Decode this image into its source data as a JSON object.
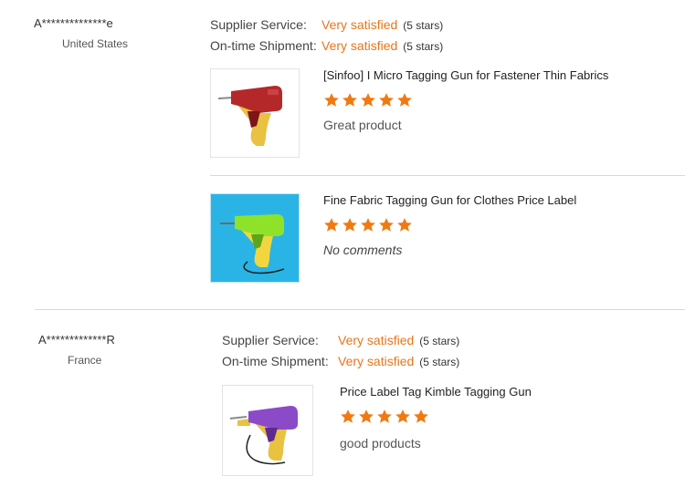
{
  "reviews": [
    {
      "buyer": {
        "name": "A**************e",
        "country": "United States"
      },
      "supplier_service": {
        "label": "Supplier Service:",
        "value": "Very satisfied",
        "stars": "(5 stars)"
      },
      "shipment": {
        "label": "On-time Shipment:",
        "value": "Very satisfied",
        "stars": "(5 stars)"
      },
      "products": [
        {
          "title": "[Sinfoo] I Micro Tagging Gun for Fastener Thin Fabrics",
          "rating": 5,
          "comment": "Great product",
          "image": "red-tagging-gun-image"
        },
        {
          "title": "Fine Fabric Tagging Gun for Clothes Price Label",
          "rating": 5,
          "comment": "No comments",
          "image": "green-tagging-gun-image"
        }
      ]
    },
    {
      "buyer": {
        "name": "A*************R",
        "country": "France"
      },
      "supplier_service": {
        "label": "Supplier Service:",
        "value": "Very satisfied",
        "stars": "(5 stars)"
      },
      "shipment": {
        "label": "On-time Shipment:",
        "value": "Very satisfied",
        "stars": "(5 stars)"
      },
      "products": [
        {
          "title": "Price Label Tag Kimble Tagging Gun",
          "rating": 5,
          "comment": "good products",
          "image": "purple-tagging-gun-image"
        }
      ]
    }
  ],
  "colors": {
    "accent": "#e8751a",
    "star": "#f07a12",
    "divider": "#d9d9d9"
  }
}
